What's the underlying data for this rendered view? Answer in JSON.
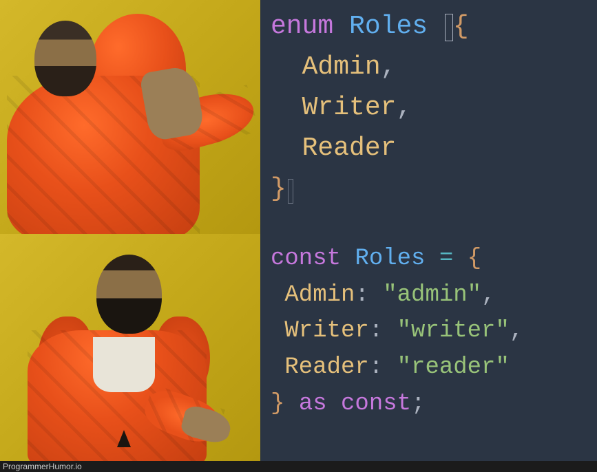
{
  "code_top": {
    "keyword": "enum",
    "name": "Roles",
    "brace_open": "{",
    "members": [
      {
        "name": "Admin",
        "suffix": ","
      },
      {
        "name": "Writer",
        "suffix": ","
      },
      {
        "name": "Reader",
        "suffix": ""
      }
    ],
    "brace_close": "}"
  },
  "code_bottom": {
    "keyword": "const",
    "name": "Roles",
    "eq": "=",
    "brace_open": "{",
    "members": [
      {
        "key": "Admin",
        "value": "\"admin\"",
        "suffix": ","
      },
      {
        "key": "Writer",
        "value": "\"writer\"",
        "suffix": ","
      },
      {
        "key": "Reader",
        "value": "\"reader\"",
        "suffix": ""
      }
    ],
    "brace_close": "}",
    "as": "as",
    "const2": "const",
    "semi": ";"
  },
  "watermark": "ProgrammerHumor.io"
}
